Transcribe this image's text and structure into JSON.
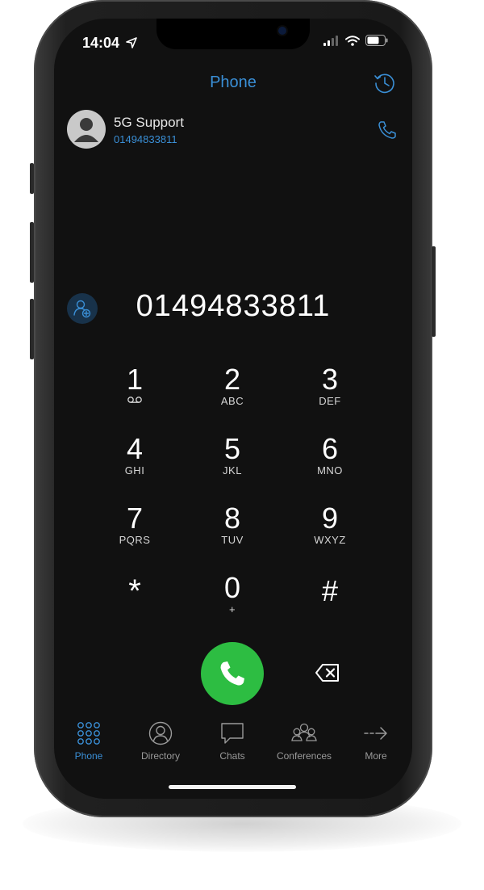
{
  "status": {
    "time": "14:04"
  },
  "header": {
    "title": "Phone"
  },
  "recent": {
    "name": "5G Support",
    "number": "01494833811"
  },
  "dialer": {
    "number": "01494833811"
  },
  "keypad": [
    {
      "digit": "1",
      "sub": ""
    },
    {
      "digit": "2",
      "sub": "ABC"
    },
    {
      "digit": "3",
      "sub": "DEF"
    },
    {
      "digit": "4",
      "sub": "GHI"
    },
    {
      "digit": "5",
      "sub": "JKL"
    },
    {
      "digit": "6",
      "sub": "MNO"
    },
    {
      "digit": "7",
      "sub": "PQRS"
    },
    {
      "digit": "8",
      "sub": "TUV"
    },
    {
      "digit": "9",
      "sub": "WXYZ"
    },
    {
      "digit": "*",
      "sub": ""
    },
    {
      "digit": "0",
      "sub": "+"
    },
    {
      "digit": "#",
      "sub": ""
    }
  ],
  "tabs": [
    {
      "label": "Phone",
      "icon": "keypad-grid-icon",
      "active": true
    },
    {
      "label": "Directory",
      "icon": "person-circle-icon",
      "active": false
    },
    {
      "label": "Chats",
      "icon": "chat-bubble-icon",
      "active": false
    },
    {
      "label": "Conferences",
      "icon": "group-icon",
      "active": false
    },
    {
      "label": "More",
      "icon": "arrow-right-icon",
      "active": false
    }
  ],
  "colors": {
    "accent": "#3a8fd6",
    "call": "#2dbd42",
    "background": "#111111"
  }
}
